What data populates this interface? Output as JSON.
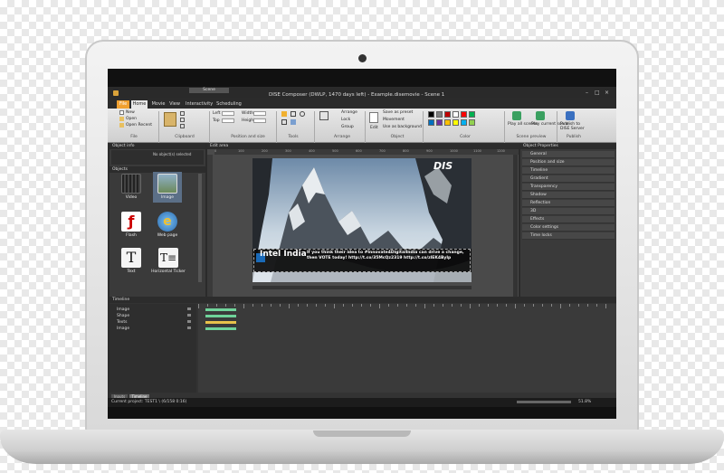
{
  "app": {
    "title": "DISE Composer (DWLP, 1470 days left) - Example.disemovie - Scene 1",
    "context_tab": "Scene",
    "tabs": [
      "File",
      "Home",
      "Movie",
      "View",
      "Interactivity",
      "Scheduling"
    ],
    "active_tab": "Home"
  },
  "ribbon": {
    "file_items": [
      "New",
      "Open",
      "Open Recent"
    ],
    "groups": [
      "File",
      "Clipboard",
      "Position and size",
      "Tools",
      "Arrange",
      "Object",
      "Color",
      "Scene preview",
      "Publish"
    ],
    "position_labels": [
      "Left",
      "Top",
      "Width",
      "Height"
    ],
    "arrange_items": [
      "Arrange",
      "Lock",
      "Group"
    ],
    "object_items": [
      "Save as preset",
      "Movement",
      "Use as background"
    ],
    "edit_label": "Edit",
    "preview_items": [
      "Play all scenes",
      "Play current scene"
    ],
    "publish_label": "Publish to DISE Server",
    "swatches": [
      "#000000",
      "#7f7f7f",
      "#c00000",
      "#ffffff",
      "#ff0000",
      "#00b050",
      "#0070c0",
      "#7030a0",
      "#ffc000",
      "#ffff00",
      "#00b0f0",
      "#92d050"
    ]
  },
  "object_info": {
    "title": "Object info",
    "placeholder": "No object(s) selected"
  },
  "objects_panel": {
    "title": "Objects",
    "items": [
      {
        "label": "Video",
        "icon": "film-icon"
      },
      {
        "label": "Image",
        "icon": "image-icon"
      },
      {
        "label": "Flash",
        "icon": "flash-icon"
      },
      {
        "label": "Web page",
        "icon": "ie-icon"
      },
      {
        "label": "Text",
        "icon": "text-icon"
      },
      {
        "label": "Horizontal Ticker",
        "icon": "ticker-icon"
      }
    ],
    "bottom_tabs": [
      "Library",
      "File Browser",
      "Content",
      "Objects"
    ]
  },
  "edit_area": {
    "title": "Edit area",
    "ruler_ticks": [
      "0",
      "100",
      "200",
      "300",
      "400",
      "500",
      "600",
      "700",
      "800",
      "900",
      "1000",
      "1100",
      "1200"
    ],
    "slide": {
      "logo": "DIS",
      "ticker_title": "Intel India",
      "ticker_text": "If you think their idea to #Innovate4DigitalIndia can drive a change, then VOTE today! http://t.co/35McQz2319 http://t.co/zlEK4ByIp"
    }
  },
  "object_properties": {
    "title": "Object Properties",
    "items": [
      "General",
      "Position and size",
      "Timeline",
      "Gradient",
      "Transparency",
      "Shadow",
      "Reflection",
      "3D",
      "Effects",
      "Color settings",
      "Time locks"
    ]
  },
  "timeline": {
    "title": "Timeline",
    "rows": [
      "Image",
      "Shape",
      "Texts",
      "Image"
    ],
    "bottom_tabs": [
      "Inputs",
      "Timeline"
    ]
  },
  "status": {
    "current_project": "Current project: TEST1 \\ (6/158 0:16)",
    "zoom": "51.8%"
  },
  "colors": {
    "accent": "#f0a030",
    "timeline_bar": "#6fd39a",
    "panel_bg": "#3a3a3a"
  }
}
